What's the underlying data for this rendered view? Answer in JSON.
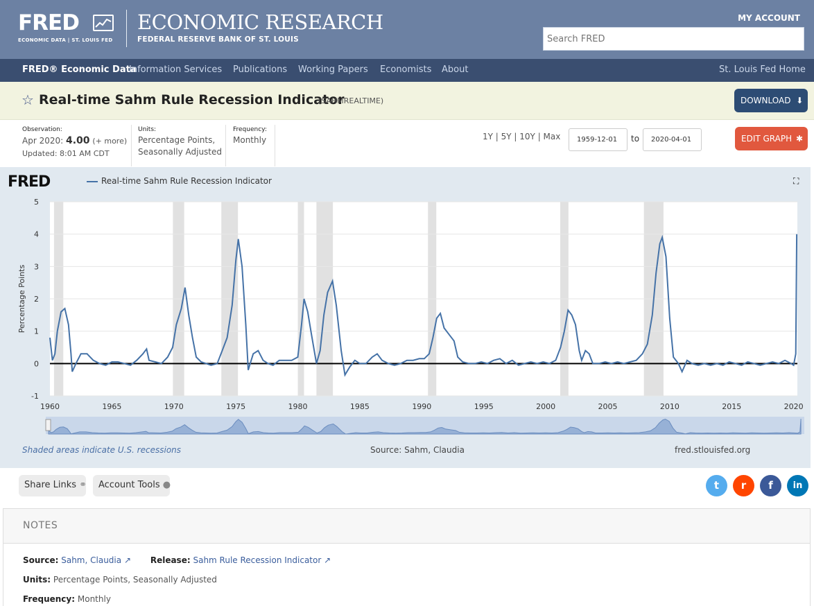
{
  "header": {
    "logo": "FRED",
    "logo_sub": "ECONOMIC DATA  |  ST. LOUIS FED",
    "title": "ECONOMIC RESEARCH",
    "subtitle": "FEDERAL RESERVE BANK OF ST. LOUIS",
    "account": "MY ACCOUNT",
    "search_placeholder": "Search FRED"
  },
  "nav": {
    "items": [
      "FRED® Economic Data",
      "Information Services",
      "Publications",
      "Working Papers",
      "Economists",
      "About"
    ],
    "right": "St. Louis Fed Home"
  },
  "series": {
    "title": "Real-time Sahm Rule Recession Indicator",
    "id": "(SAHMREALTIME)",
    "download": "DOWNLOAD"
  },
  "meta": {
    "obs_label": "Observation:",
    "obs_date": "Apr 2020:",
    "obs_value": "4.00",
    "obs_more": "(+ more)",
    "updated": "Updated: 8:01 AM CDT",
    "units_label": "Units:",
    "units_value": "Percentage Points,",
    "units_value2": "Seasonally Adjusted",
    "freq_label": "Frequency:",
    "freq_value": "Monthly",
    "ranges": "1Y | 5Y | 10Y | Max",
    "start_date": "1959-12-01",
    "to": "to",
    "end_date": "2020-04-01",
    "edit": "EDIT GRAPH"
  },
  "chart": {
    "logo": "FRED",
    "legend": "Real-time Sahm Rule Recession Indicator",
    "footer_note": "Shaded areas indicate U.S. recessions",
    "footer_source": "Source: Sahm, Claudia",
    "footer_url": "fred.stlouisfed.org"
  },
  "chart_data": {
    "type": "line",
    "ylabel": "Percentage Points",
    "ylim": [
      -1,
      5
    ],
    "yticks": [
      -1,
      0,
      1,
      2,
      3,
      4,
      5
    ],
    "xticks": [
      1960,
      1965,
      1970,
      1975,
      1980,
      1985,
      1990,
      1995,
      2000,
      2005,
      2010,
      2015,
      2020
    ],
    "recessions": [
      [
        1960.33,
        1961.08
      ],
      [
        1969.92,
        1970.83
      ],
      [
        1973.83,
        1975.17
      ],
      [
        1980.0,
        1980.5
      ],
      [
        1981.5,
        1982.83
      ],
      [
        1990.5,
        1991.17
      ],
      [
        2001.17,
        2001.83
      ],
      [
        2007.92,
        2009.5
      ]
    ],
    "series": [
      {
        "name": "Real-time Sahm Rule Recession Indicator",
        "color": "#4572a7",
        "points": [
          [
            1960.0,
            0.8
          ],
          [
            1960.2,
            0.1
          ],
          [
            1960.4,
            0.3
          ],
          [
            1960.6,
            1.0
          ],
          [
            1960.9,
            1.6
          ],
          [
            1961.2,
            1.7
          ],
          [
            1961.5,
            1.2
          ],
          [
            1961.7,
            0.3
          ],
          [
            1961.8,
            -0.25
          ],
          [
            1962.1,
            0.0
          ],
          [
            1962.5,
            0.3
          ],
          [
            1963.0,
            0.3
          ],
          [
            1963.5,
            0.1
          ],
          [
            1964.0,
            0.0
          ],
          [
            1964.5,
            -0.05
          ],
          [
            1965.0,
            0.05
          ],
          [
            1965.5,
            0.05
          ],
          [
            1966.0,
            0.0
          ],
          [
            1966.5,
            -0.05
          ],
          [
            1967.0,
            0.1
          ],
          [
            1967.5,
            0.3
          ],
          [
            1967.8,
            0.45
          ],
          [
            1968.0,
            0.1
          ],
          [
            1968.5,
            0.05
          ],
          [
            1969.0,
            0.0
          ],
          [
            1969.5,
            0.2
          ],
          [
            1969.9,
            0.5
          ],
          [
            1970.2,
            1.2
          ],
          [
            1970.6,
            1.7
          ],
          [
            1970.9,
            2.35
          ],
          [
            1971.2,
            1.5
          ],
          [
            1971.5,
            0.8
          ],
          [
            1971.8,
            0.2
          ],
          [
            1972.2,
            0.05
          ],
          [
            1972.6,
            0.0
          ],
          [
            1973.0,
            -0.05
          ],
          [
            1973.5,
            0.0
          ],
          [
            1973.9,
            0.4
          ],
          [
            1974.3,
            0.8
          ],
          [
            1974.7,
            1.8
          ],
          [
            1975.0,
            3.2
          ],
          [
            1975.2,
            3.85
          ],
          [
            1975.5,
            3.0
          ],
          [
            1975.8,
            1.2
          ],
          [
            1976.0,
            -0.2
          ],
          [
            1976.4,
            0.3
          ],
          [
            1976.8,
            0.4
          ],
          [
            1977.2,
            0.1
          ],
          [
            1977.6,
            0.0
          ],
          [
            1978.0,
            -0.05
          ],
          [
            1978.5,
            0.1
          ],
          [
            1979.0,
            0.1
          ],
          [
            1979.5,
            0.1
          ],
          [
            1980.0,
            0.2
          ],
          [
            1980.3,
            1.2
          ],
          [
            1980.5,
            2.0
          ],
          [
            1980.8,
            1.6
          ],
          [
            1981.1,
            0.9
          ],
          [
            1981.5,
            0.0
          ],
          [
            1981.8,
            0.4
          ],
          [
            1982.1,
            1.5
          ],
          [
            1982.4,
            2.2
          ],
          [
            1982.8,
            2.55
          ],
          [
            1983.1,
            1.8
          ],
          [
            1983.5,
            0.4
          ],
          [
            1983.8,
            -0.35
          ],
          [
            1984.2,
            -0.1
          ],
          [
            1984.6,
            0.1
          ],
          [
            1985.0,
            0.0
          ],
          [
            1985.5,
            0.0
          ],
          [
            1986.0,
            0.2
          ],
          [
            1986.4,
            0.3
          ],
          [
            1986.8,
            0.1
          ],
          [
            1987.3,
            0.0
          ],
          [
            1987.8,
            -0.05
          ],
          [
            1988.3,
            0.0
          ],
          [
            1988.8,
            0.1
          ],
          [
            1989.3,
            0.1
          ],
          [
            1989.8,
            0.15
          ],
          [
            1990.2,
            0.15
          ],
          [
            1990.6,
            0.3
          ],
          [
            1990.9,
            0.8
          ],
          [
            1991.2,
            1.4
          ],
          [
            1991.5,
            1.55
          ],
          [
            1991.8,
            1.1
          ],
          [
            1992.2,
            0.9
          ],
          [
            1992.6,
            0.7
          ],
          [
            1992.9,
            0.2
          ],
          [
            1993.3,
            0.05
          ],
          [
            1993.8,
            0.0
          ],
          [
            1994.3,
            0.0
          ],
          [
            1994.8,
            0.05
          ],
          [
            1995.3,
            0.0
          ],
          [
            1995.8,
            0.1
          ],
          [
            1996.3,
            0.15
          ],
          [
            1996.8,
            0.0
          ],
          [
            1997.3,
            0.1
          ],
          [
            1997.8,
            -0.05
          ],
          [
            1998.3,
            0.0
          ],
          [
            1998.8,
            0.05
          ],
          [
            1999.3,
            0.0
          ],
          [
            1999.8,
            0.05
          ],
          [
            2000.3,
            0.0
          ],
          [
            2000.8,
            0.1
          ],
          [
            2001.2,
            0.5
          ],
          [
            2001.5,
            1.0
          ],
          [
            2001.8,
            1.65
          ],
          [
            2002.1,
            1.5
          ],
          [
            2002.4,
            1.2
          ],
          [
            2002.7,
            0.4
          ],
          [
            2002.9,
            0.1
          ],
          [
            2003.2,
            0.4
          ],
          [
            2003.5,
            0.3
          ],
          [
            2003.8,
            0.0
          ],
          [
            2004.3,
            0.0
          ],
          [
            2004.8,
            0.05
          ],
          [
            2005.3,
            0.0
          ],
          [
            2005.8,
            0.05
          ],
          [
            2006.3,
            0.0
          ],
          [
            2006.8,
            0.05
          ],
          [
            2007.3,
            0.1
          ],
          [
            2007.8,
            0.3
          ],
          [
            2008.2,
            0.6
          ],
          [
            2008.6,
            1.5
          ],
          [
            2008.9,
            2.8
          ],
          [
            2009.2,
            3.7
          ],
          [
            2009.4,
            3.9
          ],
          [
            2009.7,
            3.3
          ],
          [
            2010.0,
            1.4
          ],
          [
            2010.3,
            0.2
          ],
          [
            2010.7,
            0.0
          ],
          [
            2011.0,
            -0.25
          ],
          [
            2011.4,
            0.1
          ],
          [
            2011.8,
            0.0
          ],
          [
            2012.3,
            -0.05
          ],
          [
            2012.8,
            0.0
          ],
          [
            2013.3,
            -0.05
          ],
          [
            2013.8,
            0.0
          ],
          [
            2014.3,
            -0.05
          ],
          [
            2014.8,
            0.05
          ],
          [
            2015.3,
            0.0
          ],
          [
            2015.8,
            -0.05
          ],
          [
            2016.3,
            0.05
          ],
          [
            2016.8,
            0.0
          ],
          [
            2017.3,
            -0.05
          ],
          [
            2017.8,
            0.0
          ],
          [
            2018.3,
            0.05
          ],
          [
            2018.8,
            0.0
          ],
          [
            2019.3,
            0.1
          ],
          [
            2019.8,
            0.0
          ],
          [
            2020.0,
            -0.05
          ],
          [
            2020.17,
            0.3
          ],
          [
            2020.25,
            4.0
          ]
        ]
      }
    ]
  },
  "actions": {
    "share": "Share Links",
    "account_tools": "Account Tools",
    "twitter": "t",
    "reddit": "r",
    "facebook": "f",
    "linkedin": "in"
  },
  "notes": {
    "heading": "NOTES",
    "source_label": "Source:",
    "source_value": "Sahm, Claudia",
    "release_label": "Release:",
    "release_value": "Sahm Rule Recession Indicator",
    "units_label": "Units:",
    "units_value": "Percentage Points, Seasonally Adjusted",
    "freq_label": "Frequency:",
    "freq_value": "Monthly"
  }
}
